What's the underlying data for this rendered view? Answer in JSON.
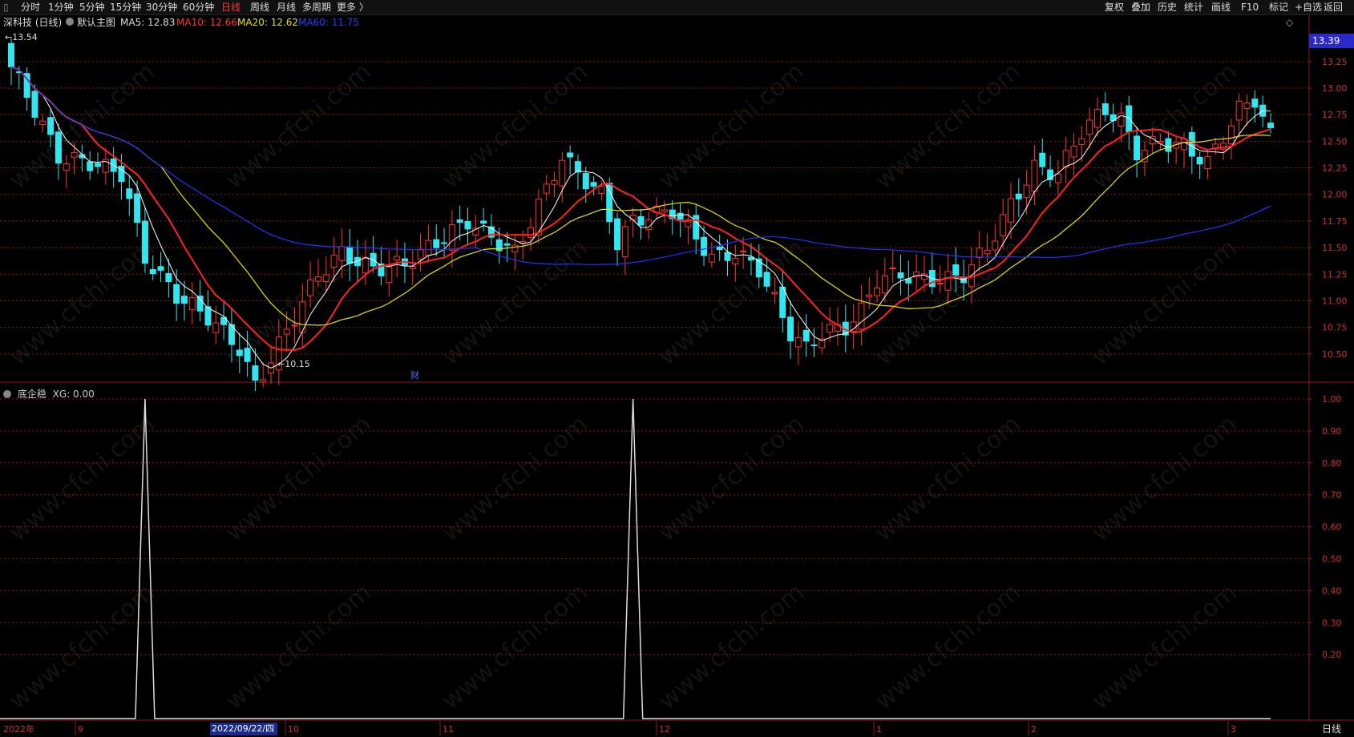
{
  "toolbar": {
    "periods": [
      "分时",
      "1分钟",
      "5分钟",
      "15分钟",
      "30分钟",
      "60分钟",
      "日线",
      "周线",
      "月线",
      "多周期",
      "更多 〉"
    ],
    "active_period": "日线",
    "right_buttons": [
      "复权",
      "叠加",
      "历史",
      "统计",
      "画线",
      "F10",
      "标记",
      "+自选",
      "返回"
    ]
  },
  "stock": {
    "name": "深科技 (日线)",
    "chart_template": "默认主图",
    "ma5": "MA5: 12.83",
    "ma10": "MA10: 12.66",
    "ma20": "MA20: 12.62",
    "ma60": "MA60: 11.75",
    "current_price": "13.39",
    "high_label": "←13.54",
    "low_label": "←10.15",
    "event_marker": "财"
  },
  "colors": {
    "up": "#ff3333",
    "down": "#33e5ee",
    "ma5": "#ffffff",
    "ma10": "#ff2222",
    "ma20": "#e6e600",
    "ma60": "#2233ff",
    "grid": "#8b1a1a"
  },
  "indicator": {
    "name": "底企稳",
    "xg_label": "XG: 0.00"
  },
  "x_axis": {
    "year_label": "2022年",
    "months": [
      "9",
      "10",
      "11",
      "12",
      "1",
      "2",
      "3"
    ],
    "cursor_date": "2022/09/22/四"
  },
  "bottom_tab": "日线",
  "watermark": "www.cfchi.com",
  "chart_data": {
    "type": "candlestick",
    "price_ticks": [
      13.25,
      13.0,
      12.75,
      12.5,
      12.25,
      12.0,
      11.75,
      11.5,
      11.25,
      11.0,
      10.75,
      10.5
    ],
    "price_range": [
      10.25,
      13.55
    ],
    "indicator_ticks": [
      1.0,
      0.9,
      0.8,
      0.7,
      0.6,
      0.5,
      0.4,
      0.3,
      0.2
    ],
    "indicator_range": [
      0,
      1
    ],
    "signals_at_bar": [
      17,
      79
    ]
  }
}
